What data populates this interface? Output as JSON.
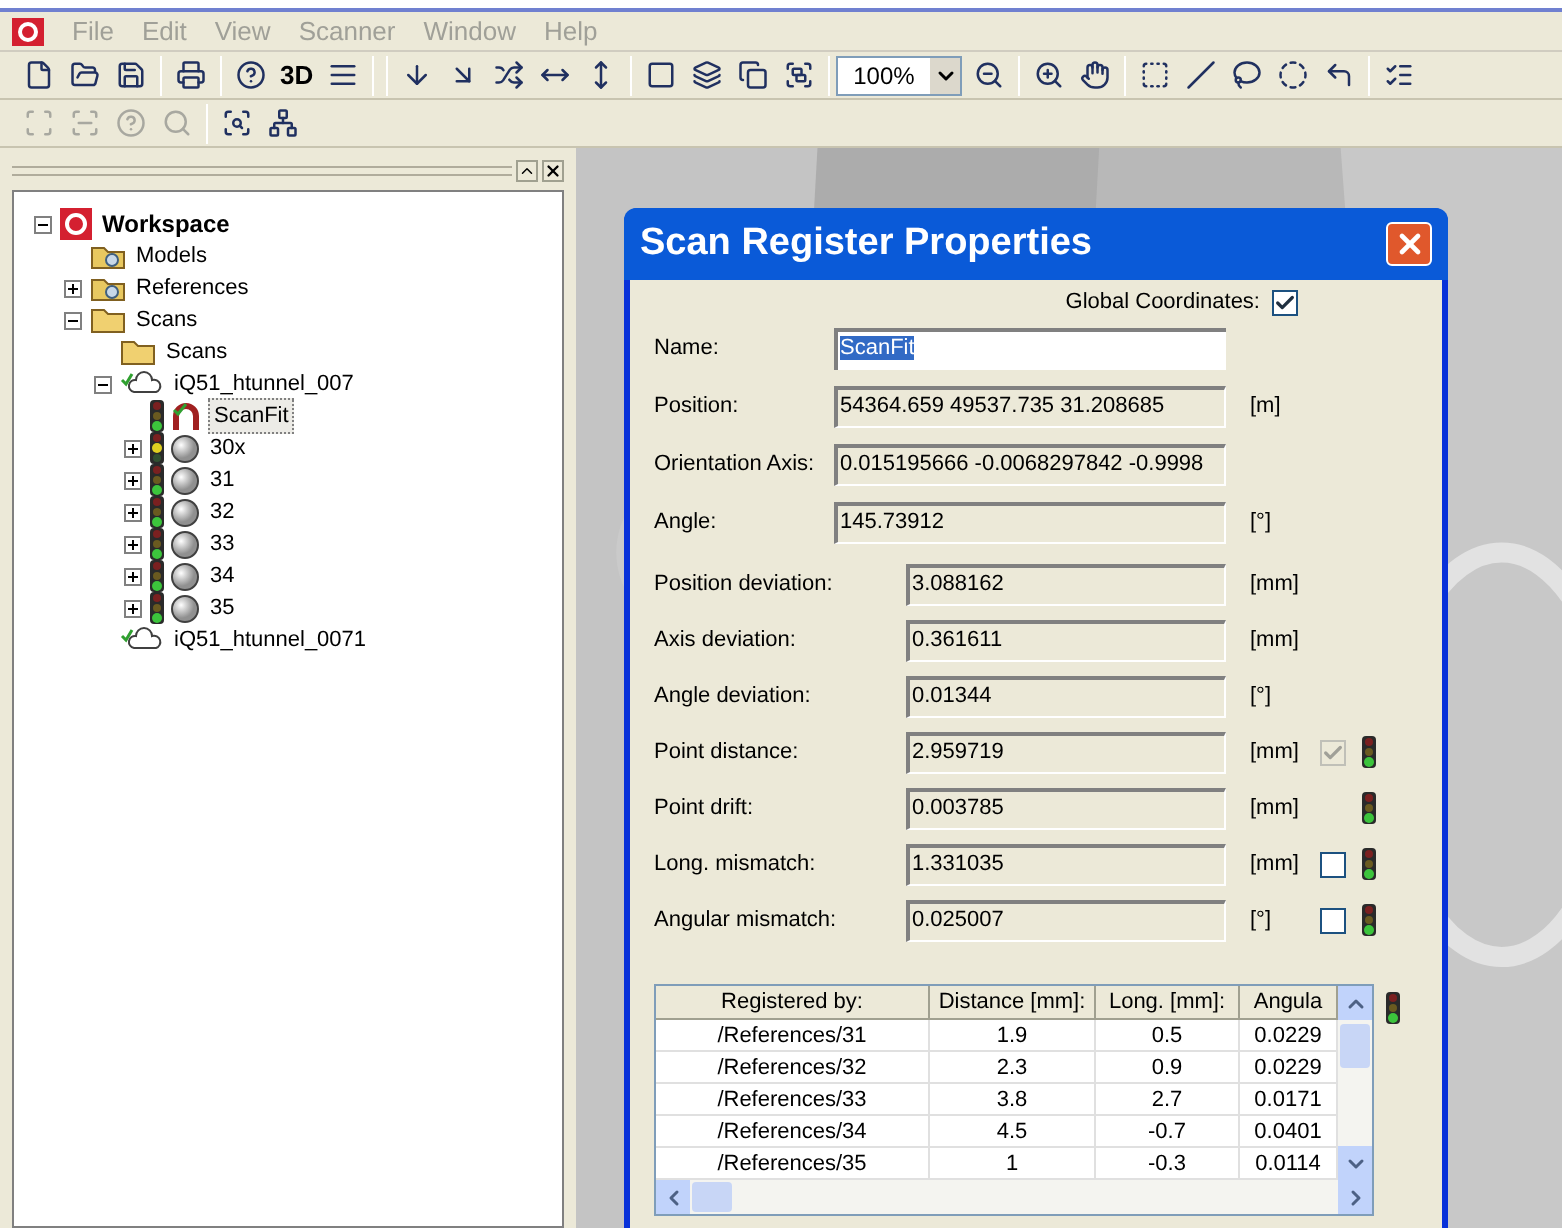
{
  "menu": [
    "File",
    "Edit",
    "View",
    "Scanner",
    "Window",
    "Help"
  ],
  "toolbar": {
    "text_button": "3D",
    "zoom": "100%"
  },
  "toolbar2": [
    {
      "disabled": true
    },
    {
      "disabled": true
    },
    {
      "disabled": true
    },
    {
      "disabled": true
    },
    {
      "disabled": false
    },
    {
      "disabled": false
    }
  ],
  "tree": [
    {
      "label": "Workspace",
      "kind": "workspace",
      "expanded": true,
      "children": [
        {
          "label": "Models",
          "kind": "group"
        },
        {
          "label": "References",
          "kind": "group",
          "expanded": false
        },
        {
          "label": "Scans",
          "kind": "folder",
          "expanded": true,
          "children": [
            {
              "label": "Scans",
              "kind": "folder"
            },
            {
              "label": "iQ51_htunnel_007",
              "kind": "scan-group",
              "expanded": true,
              "children": [
                {
                  "label": "ScanFit",
                  "kind": "scanfit",
                  "color": "#3cc43c",
                  "selected": true
                },
                {
                  "label": "30x",
                  "kind": "scan",
                  "color": "#e0d020",
                  "expanded": false,
                  "selected": false
                },
                {
                  "label": "31",
                  "kind": "scan",
                  "color": "#3cc43c",
                  "expanded": false,
                  "selected": false
                },
                {
                  "label": "32",
                  "kind": "scan",
                  "color": "#3cc43c",
                  "expanded": false,
                  "selected": false
                },
                {
                  "label": "33",
                  "kind": "scan",
                  "color": "#3cc43c",
                  "expanded": false,
                  "selected": false
                },
                {
                  "label": "34",
                  "kind": "scan",
                  "color": "#3cc43c",
                  "expanded": false,
                  "selected": false
                },
                {
                  "label": "35",
                  "kind": "scan",
                  "color": "#3cc43c",
                  "expanded": false,
                  "selected": false
                }
              ]
            },
            {
              "label": "iQ51_htunnel_0071",
              "kind": "scan-group"
            }
          ]
        }
      ]
    }
  ],
  "dialog": {
    "title": "Scan Register Properties",
    "global_coordinates": {
      "label": "Global Coordinates:",
      "checked": true
    },
    "fields": [
      {
        "kind": "name",
        "label": "Name:",
        "value": "ScanFit"
      },
      {
        "kind": "pose",
        "label": "Position:",
        "value": "54364.659 49537.735 31.208685",
        "unit": "[m]"
      },
      {
        "kind": "pose",
        "label": "Orientation Axis:",
        "value": "0.015195666 -0.0068297842 -0.9998"
      },
      {
        "kind": "pose",
        "label": "Angle:",
        "value": "145.73912",
        "unit": "[°]"
      },
      {
        "kind": "deviation",
        "label": "Position deviation:",
        "value": "3.088162",
        "unit": "[mm]"
      },
      {
        "kind": "deviation",
        "label": "Axis deviation:",
        "value": "0.361611",
        "unit": "[mm]"
      },
      {
        "kind": "deviation",
        "label": "Angle deviation:",
        "value": "0.01344",
        "unit": "[°]"
      },
      {
        "kind": "deviation",
        "label": "Point distance:",
        "value": "2.959719",
        "unit": "[mm]",
        "checkbox": {
          "checked": true,
          "disabled": true
        },
        "color": "#3cc43c"
      },
      {
        "kind": "deviation",
        "label": "Point drift:",
        "value": "0.003785",
        "unit": "[mm]",
        "color": "#3cc43c"
      },
      {
        "kind": "deviation",
        "label": "Long. mismatch:",
        "value": "1.331035",
        "unit": "[mm]",
        "checkbox": {
          "checked": false,
          "disabled": false
        },
        "color": "#3cc43c"
      },
      {
        "kind": "deviation",
        "label": "Angular mismatch:",
        "value": "0.025007",
        "unit": "[°]",
        "checkbox": {
          "checked": false,
          "disabled": false
        },
        "color": "#3cc43c"
      }
    ],
    "table": {
      "columns": [
        "Registered by:",
        "Distance [mm]:",
        "Long. [mm]:",
        "Angula"
      ],
      "color": "#3cc43c",
      "rows": [
        [
          "/References/31",
          "1.9",
          "0.5",
          "0.0229"
        ],
        [
          "/References/32",
          "2.3",
          "0.9",
          "0.0229"
        ],
        [
          "/References/33",
          "3.8",
          "2.7",
          "0.0171"
        ],
        [
          "/References/34",
          "4.5",
          "-0.7",
          "0.0401"
        ],
        [
          "/References/35",
          "1",
          "-0.3",
          "0.0114"
        ]
      ]
    }
  }
}
